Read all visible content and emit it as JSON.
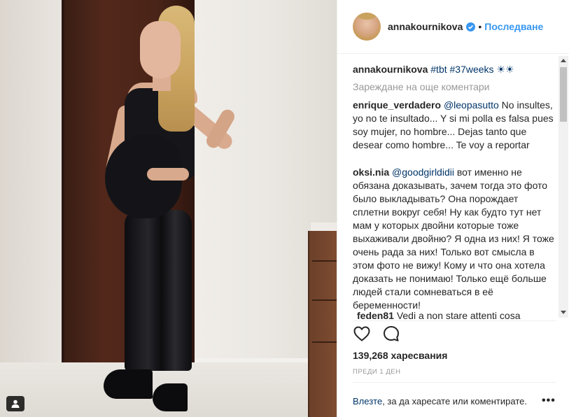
{
  "post": {
    "username": "annakournikova",
    "separator": "•",
    "follow_label": "Последване"
  },
  "caption": {
    "author": "annakournikova",
    "text": "#tbt #37weeks ☀☀"
  },
  "load_more": "Зареждане на още коментари",
  "comments": [
    {
      "author": "enrique_verdadero",
      "mention": "@leopasutto",
      "text": " No insultes, yo no te insultado... Y si mi polla es falsa pues soy mujer, no hombre... Dejas tanto que desear como hombre... Te voy a reportar"
    },
    {
      "author": "oksi.nia",
      "mention": "@goodgirldidii",
      "text": " вот именно не обязана доказывать, зачем тогда это фото было выкладывать? Она порождает сплетни вокруг себя! Ну как будто тут нет мам у которых двойни которые тоже выхаживали двойню? Я одна из них! Я тоже очень рада за них! Только вот смысла в этом фото не вижу! Кому и что она хотела доказать не понимаю! Только ещё больше людей стали сомневаться в её беременности!"
    },
    {
      "author": "feden81",
      "mention": "",
      "text": " Vedi a non stare attenti cosa"
    }
  ],
  "likes": "139,268 харесвания",
  "time": "ПРЕДИ 1 ДЕН",
  "login": {
    "link": "Влезте",
    "text": ", за да харесате или коментирате."
  },
  "more_label": "•••",
  "icons": {
    "like": "heart-icon",
    "comment": "comment-icon",
    "verified": "verified-badge-icon",
    "tag": "user-tag-icon",
    "more": "more-options-icon"
  },
  "colors": {
    "link_blue": "#3897f0",
    "mention_blue": "#003569",
    "muted": "#999999"
  }
}
